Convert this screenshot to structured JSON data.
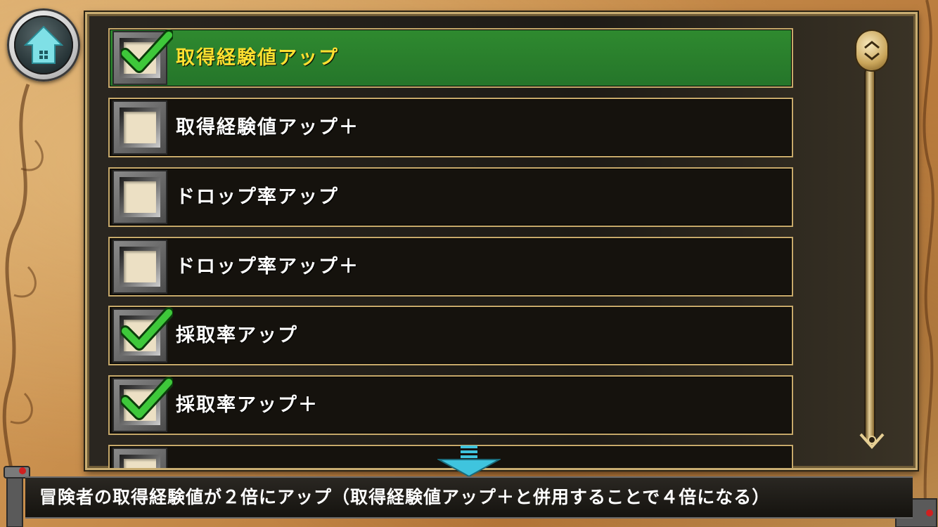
{
  "home": {
    "icon": "home-icon"
  },
  "list": {
    "items": [
      {
        "label": "取得経験値アップ",
        "checked": true,
        "selected": true
      },
      {
        "label": "取得経験値アップ＋",
        "checked": false,
        "selected": false
      },
      {
        "label": "ドロップ率アップ",
        "checked": false,
        "selected": false
      },
      {
        "label": "ドロップ率アップ＋",
        "checked": false,
        "selected": false
      },
      {
        "label": "採取率アップ",
        "checked": true,
        "selected": false
      },
      {
        "label": "採取率アップ＋",
        "checked": true,
        "selected": false
      },
      {
        "label": "",
        "checked": false,
        "selected": false
      }
    ]
  },
  "description": "冒険者の取得経験値が２倍にアップ（取得経験値アップ＋と併用することで４倍になる）",
  "colors": {
    "selected_row": "#2f8a2f",
    "selected_text": "#ffe030",
    "check_green": "#3ec83a",
    "frame_gold": "#c9ad72"
  }
}
